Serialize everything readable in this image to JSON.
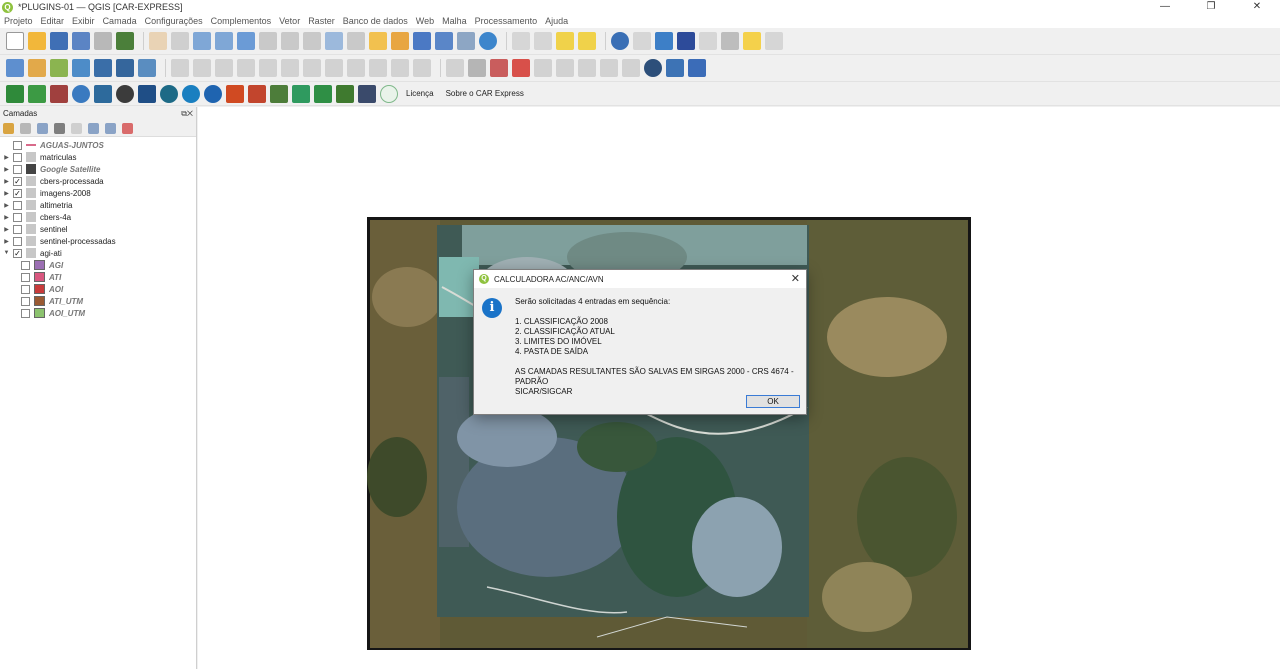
{
  "window": {
    "title": "*PLUGINS-01 — QGIS [CAR-EXPRESS]",
    "app_icon": "qgis-icon"
  },
  "menu": [
    "Projeto",
    "Editar",
    "Exibir",
    "Camada",
    "Configurações",
    "Complementos",
    "Vetor",
    "Raster",
    "Banco de dados",
    "Web",
    "Malha",
    "Processamento",
    "Ajuda"
  ],
  "plugin_toolbar": {
    "license_label": "Licença",
    "about_label": "Sobre o CAR Express"
  },
  "layers_panel": {
    "title": "Camadas",
    "layers": [
      {
        "name": "AGUAS-JUNTOS",
        "checked": false,
        "expandable": false,
        "italic": true,
        "icon": "line-icon"
      },
      {
        "name": "matriculas",
        "checked": false,
        "expandable": true,
        "italic": false,
        "icon": "group-icon"
      },
      {
        "name": "Google Satellite",
        "checked": false,
        "expandable": true,
        "italic": true,
        "icon": "xyz-tile-icon"
      },
      {
        "name": "cbers-processada",
        "checked": true,
        "expandable": true,
        "italic": false,
        "icon": "group-icon"
      },
      {
        "name": "imagens-2008",
        "checked": true,
        "expandable": true,
        "italic": false,
        "icon": "group-icon"
      },
      {
        "name": "altimetria",
        "checked": false,
        "expandable": true,
        "italic": false,
        "icon": "group-icon"
      },
      {
        "name": "cbers-4a",
        "checked": false,
        "expandable": true,
        "italic": false,
        "icon": "group-icon"
      },
      {
        "name": "sentinel",
        "checked": false,
        "expandable": true,
        "italic": false,
        "icon": "group-icon"
      },
      {
        "name": "sentinel-processadas",
        "checked": false,
        "expandable": true,
        "italic": false,
        "icon": "group-icon"
      },
      {
        "name": "agi-ati",
        "checked": true,
        "expandable": true,
        "expanded": true,
        "italic": false,
        "icon": "group-icon"
      }
    ],
    "sublayers": [
      {
        "name": "AGI",
        "color": "#9b6fb3"
      },
      {
        "name": "ATI",
        "color": "#d9577f"
      },
      {
        "name": "AOI",
        "color": "#c83b3b"
      },
      {
        "name": "ATI_UTM",
        "color": "#9a5a33"
      },
      {
        "name": "AOI_UTM",
        "color": "#8cc36f"
      }
    ]
  },
  "dialog": {
    "title": "CALCULADORA AC/ANC/AVN",
    "intro": "Serão solicitadas 4 entradas em sequência:",
    "items": [
      "1. CLASSIFICAÇÃO 2008",
      "2. CLASSIFICAÇÃO ATUAL",
      "3. LIMITES DO IMÓVEL",
      "4. PASTA DE SAÍDA"
    ],
    "note_line1": "AS CAMADAS RESULTANTES SÃO SALVAS EM SIRGAS 2000 - CRS 4674 - PADRÃO",
    "note_line2": "SICAR/SIGCAR",
    "ok_label": "OK",
    "icon": "info-icon"
  },
  "colors": {
    "accent": "#3a7bd5",
    "qgis_green": "#8fc23f"
  }
}
